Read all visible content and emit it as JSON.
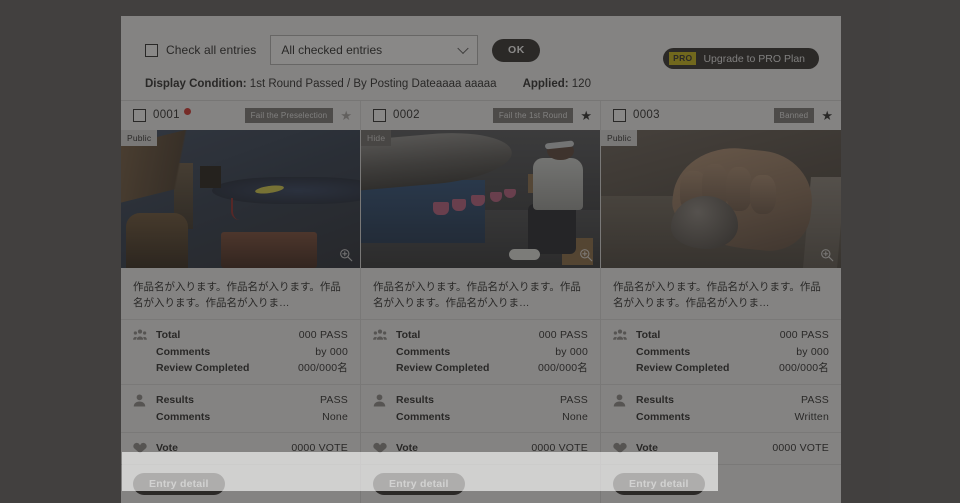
{
  "toolbar": {
    "check_all_label": "Check all entries",
    "bulk_action_selected": "All checked entries",
    "ok_label": "OK",
    "pro_badge": "PRO",
    "pro_label": "Upgrade to PRO Plan",
    "condition_key": "Display Condition:",
    "condition_value": "1st Round Passed / By Posting Dateaaaa aaaaa",
    "applied_key": "Applied:",
    "applied_value": "120"
  },
  "colors": {
    "accent_dark": "#2f2d2c",
    "pro_yellow": "#c9b815",
    "alert_dot": "#d6322b",
    "panel_bg": "#f3f3f3",
    "scrim": "#636160"
  },
  "cards": [
    {
      "entry_no": "0001",
      "has_alert_dot": true,
      "status_tag": "Fail the Preselection",
      "starred": false,
      "visibility_badge": "Public",
      "title": "作品名が入ります。作品名が入ります。作品名が入ります。作品名が入りま…",
      "groups": [
        {
          "icon": "people-icon",
          "rows": [
            {
              "key": "Total",
              "value": "000 PASS"
            },
            {
              "key": "Comments",
              "value": "by 000"
            },
            {
              "key": "Review Completed",
              "value": "000/000名"
            }
          ]
        },
        {
          "icon": "person-icon",
          "rows": [
            {
              "key": "Results",
              "value": "PASS"
            },
            {
              "key": "Comments",
              "value": "None"
            }
          ]
        },
        {
          "icon": "heart-icon",
          "rows": [
            {
              "key": "Vote",
              "value": "0000 VOTE"
            }
          ]
        }
      ],
      "detail_label": "Entry detail"
    },
    {
      "entry_no": "0002",
      "has_alert_dot": false,
      "status_tag": "Fail the 1st Round",
      "starred": true,
      "visibility_badge": "Hide",
      "title": "作品名が入ります。作品名が入ります。作品名が入ります。作品名が入りま…",
      "groups": [
        {
          "icon": "people-icon",
          "rows": [
            {
              "key": "Total",
              "value": "000 PASS"
            },
            {
              "key": "Comments",
              "value": "by 000"
            },
            {
              "key": "Review Completed",
              "value": "000/000名"
            }
          ]
        },
        {
          "icon": "person-icon",
          "rows": [
            {
              "key": "Results",
              "value": "PASS"
            },
            {
              "key": "Comments",
              "value": "None"
            }
          ]
        },
        {
          "icon": "heart-icon",
          "rows": [
            {
              "key": "Vote",
              "value": "0000 VOTE"
            }
          ]
        }
      ],
      "detail_label": "Entry detail"
    },
    {
      "entry_no": "0003",
      "has_alert_dot": false,
      "status_tag": "Banned",
      "starred": true,
      "visibility_badge": "Public",
      "title": "作品名が入ります。作品名が入ります。作品名が入ります。作品名が入りま…",
      "groups": [
        {
          "icon": "people-icon",
          "rows": [
            {
              "key": "Total",
              "value": "000 PASS"
            },
            {
              "key": "Comments",
              "value": "by 000"
            },
            {
              "key": "Review Completed",
              "value": "000/000名"
            }
          ]
        },
        {
          "icon": "person-icon",
          "rows": [
            {
              "key": "Results",
              "value": "PASS"
            },
            {
              "key": "Comments",
              "value": "Written"
            }
          ]
        },
        {
          "icon": "heart-icon",
          "rows": [
            {
              "key": "Vote",
              "value": "0000 VOTE"
            }
          ]
        }
      ],
      "detail_label": "Entry detail"
    }
  ]
}
